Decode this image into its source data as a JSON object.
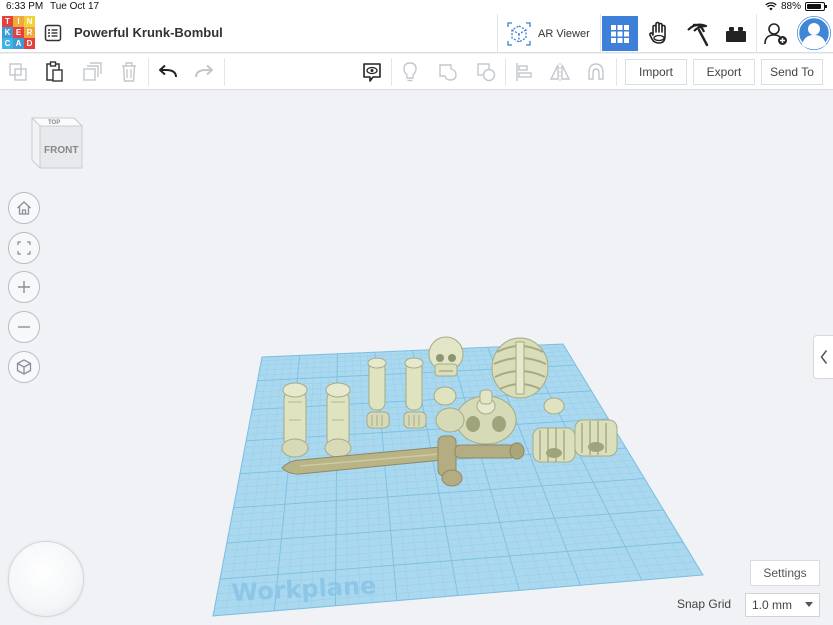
{
  "status_bar": {
    "time": "6:33 PM",
    "date": "Tue Oct 17",
    "battery": "88%"
  },
  "logo": {
    "letters": [
      "T",
      "I",
      "N",
      "K",
      "E",
      "R",
      "C",
      "A",
      "D"
    ],
    "colors": [
      "#e3413b",
      "#f0a93b",
      "#f2d23b",
      "#3f9ad7",
      "#e3413b",
      "#f0a93b",
      "#3fb3e3",
      "#3f9ad7",
      "#e3413b"
    ]
  },
  "header": {
    "design_title": "Powerful Krunk-Bombul",
    "ar_viewer_label": "AR Viewer",
    "icons": [
      "grid-view-icon",
      "hand-blocks-icon",
      "pickaxe-icon",
      "bricks-icon",
      "add-user-icon",
      "user-avatar"
    ]
  },
  "toolbar": {
    "import_label": "Import",
    "export_label": "Export",
    "send_to_label": "Send To"
  },
  "viewcube": {
    "top_label": "TOP",
    "front_label": "FRONT"
  },
  "workspace": {
    "workplane_label": "Workplane",
    "settings_label": "Settings",
    "snap_grid_label": "Snap Grid",
    "snap_grid_value": "1.0 mm"
  },
  "colors": {
    "accent": "#3d7fd9",
    "workplane": "#a9d8ef",
    "grid_line": "#8cc6e4",
    "model": "#dfe3c0",
    "model_shade": "#b9bf96",
    "sword": "#b4ad83"
  }
}
